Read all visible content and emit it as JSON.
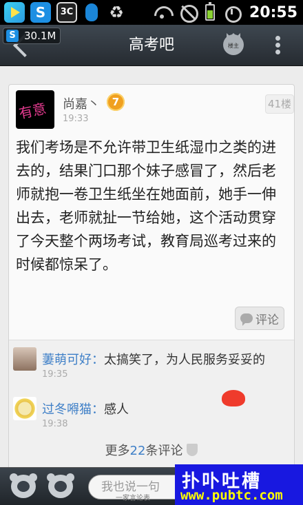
{
  "status_bar": {
    "time": "20:55",
    "apps": [
      "play-store-icon",
      "360-security-icon",
      "cpu-monitor-icon",
      "qq-icon",
      "recycle-icon"
    ],
    "icons": [
      "wifi-icon",
      "no-signal-icon",
      "battery-icon",
      "alarm-icon"
    ],
    "app_360_glyph": "S",
    "app_cpu_glyph": "3C",
    "recycle_glyph": "♻"
  },
  "overlay": {
    "memory_badge_glyph": "S",
    "memory": "30.1M"
  },
  "header": {
    "title": "高考吧",
    "owner_label": "楼主"
  },
  "post": {
    "username": "尚嘉丶",
    "level": "7",
    "time": "19:33",
    "floor": "41楼",
    "body": "我们考场是不允许带卫生纸湿巾之类的进去的，结果门口那个妹子感冒了，然后老师就抱一卷卫生纸坐在她面前，她手一伸出去，老师就扯一节给她，这个活动贯穿了今天整个两场考试，教育局巡考过来的时候都惊呆了。",
    "comment_button": "评论"
  },
  "replies": [
    {
      "user": "萋萌可好：",
      "text": "太搞笑了，为人民服务妥妥的",
      "time": "19:35"
    },
    {
      "user": "过冬嘚猫：",
      "text": "感人",
      "time": "19:38"
    }
  ],
  "more_comments": {
    "prefix": "更多",
    "count": "22",
    "suffix": "条评论"
  },
  "bottom_bar": {
    "input_placeholder": "我也说一句"
  },
  "watermark": {
    "small": "一家言论表",
    "line1": "扑卟吐槽",
    "line2": "www.pubtc.com"
  },
  "colors": {
    "title_bar": "#2e353c",
    "link_blue": "#3e7fc7",
    "level_badge": "#f0a020",
    "watermark_bg": "#1818e0"
  }
}
